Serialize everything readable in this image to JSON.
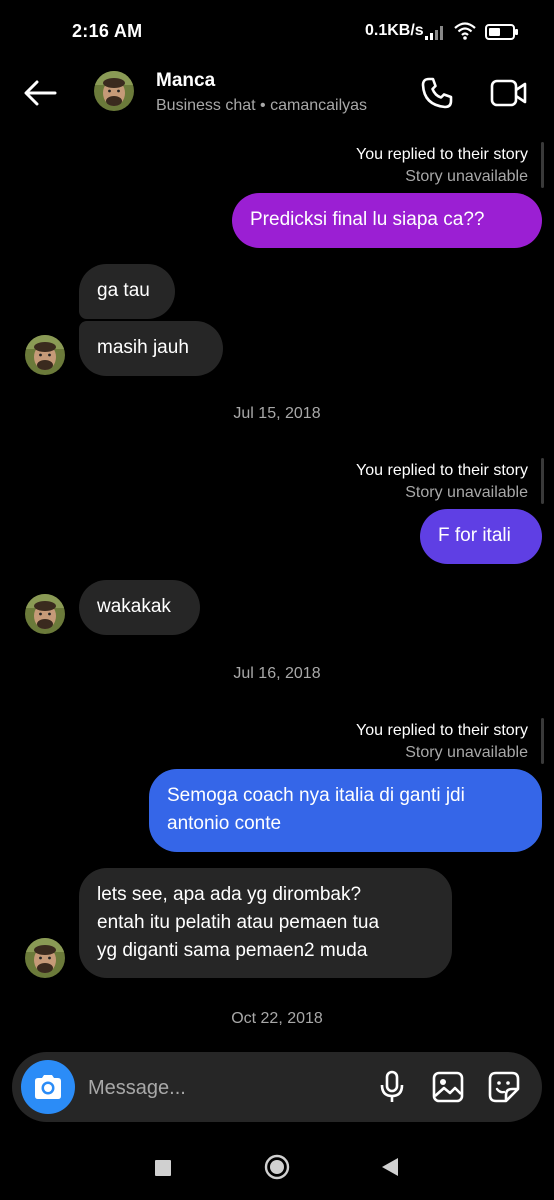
{
  "status_bar": {
    "time": "2:16 AM",
    "network_speed": "0.1KB/s",
    "signal_icon": "signal-bars-icon",
    "wifi_icon": "wifi-icon",
    "battery_icon": "battery-icon"
  },
  "header": {
    "name": "Manca",
    "subtitle": "Business chat • camancailyas",
    "back_icon": "arrow-left-icon",
    "call_icon": "phone-icon",
    "video_icon": "video-camera-icon"
  },
  "conversation": {
    "reply_label": "You replied to their story",
    "reply_status": "Story unavailable",
    "outgoing_1": "Predicksi final lu siapa ca??",
    "incoming_1": "ga tau",
    "incoming_2": "masih jauh",
    "date_1": "Jul 15, 2018",
    "outgoing_2": "F for itali",
    "incoming_3": "wakakak",
    "date_2": "Jul 16, 2018",
    "outgoing_3_line1": "Semoga coach nya italia di ganti jdi",
    "outgoing_3_line2": "antonio conte",
    "incoming_4_line1": "lets see, apa ada yg dirombak?",
    "incoming_4_line2": "entah itu pelatih atau pemaen tua",
    "incoming_4_line3": "yg diganti sama pemaen2 muda",
    "date_3": "Oct 22, 2018"
  },
  "composer": {
    "placeholder": "Message...",
    "camera_icon": "camera-icon",
    "mic_icon": "microphone-icon",
    "gallery_icon": "gallery-icon",
    "sticker_icon": "sticker-icon"
  },
  "colors": {
    "background": "#000000",
    "incoming_bubble": "#262626",
    "outgoing_purple": "#9b1fd3",
    "outgoing_violet": "#5f3fe4",
    "outgoing_blue": "#3566e8",
    "camera_button": "#2b8cf7"
  },
  "nav_bar": {
    "recents_icon": "square-recents-icon",
    "home_icon": "circle-home-icon",
    "back_icon": "triangle-back-icon"
  }
}
